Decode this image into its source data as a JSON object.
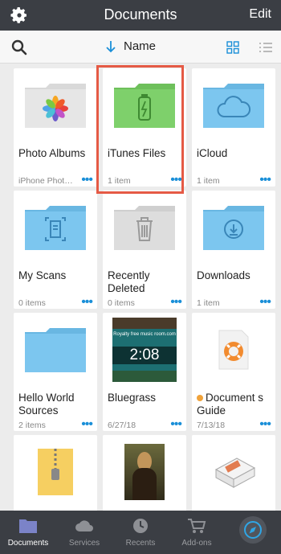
{
  "header": {
    "title": "Documents",
    "edit_label": "Edit"
  },
  "sortbar": {
    "sort_label": "Name"
  },
  "items": [
    {
      "name": "Photo Albums",
      "meta": "iPhone Phot…",
      "icon": "photos-folder-icon"
    },
    {
      "name": "iTunes Files",
      "meta": "1 item",
      "icon": "itunes-folder-icon"
    },
    {
      "name": "iCloud",
      "meta": "1 item",
      "icon": "icloud-folder-icon"
    },
    {
      "name": "My Scans",
      "meta": "0 items",
      "icon": "scans-folder-icon"
    },
    {
      "name": "Recently Deleted",
      "meta": "0 items",
      "icon": "trash-folder-icon"
    },
    {
      "name": "Downloads",
      "meta": "1 item",
      "icon": "downloads-folder-icon"
    },
    {
      "name": "Hello World Sources",
      "meta": "2 items",
      "icon": "folder-icon"
    },
    {
      "name": "Bluegrass",
      "meta": "6/27/18",
      "icon": "video-thumbnail",
      "thumb_text": "Royalty free music room.com",
      "thumb_time": "2:08"
    },
    {
      "name": "Document s Guide",
      "meta": "7/13/18",
      "icon": "lifebuoy-icon"
    },
    {
      "name": "",
      "meta": "",
      "icon": "zip-file-icon"
    },
    {
      "name": "",
      "meta": "",
      "icon": "mona-lisa-image"
    },
    {
      "name": "",
      "meta": "",
      "icon": "package-icon"
    }
  ],
  "tabs": [
    {
      "label": "Documents",
      "active": true
    },
    {
      "label": "Services"
    },
    {
      "label": "Recents"
    },
    {
      "label": "Add-ons"
    }
  ],
  "colors": {
    "folder_blue": "#7cc6ef",
    "folder_green": "#7ed06b",
    "folder_gray": "#d9d9d9",
    "accent": "#1a8fd8",
    "highlight": "#e55a45"
  }
}
